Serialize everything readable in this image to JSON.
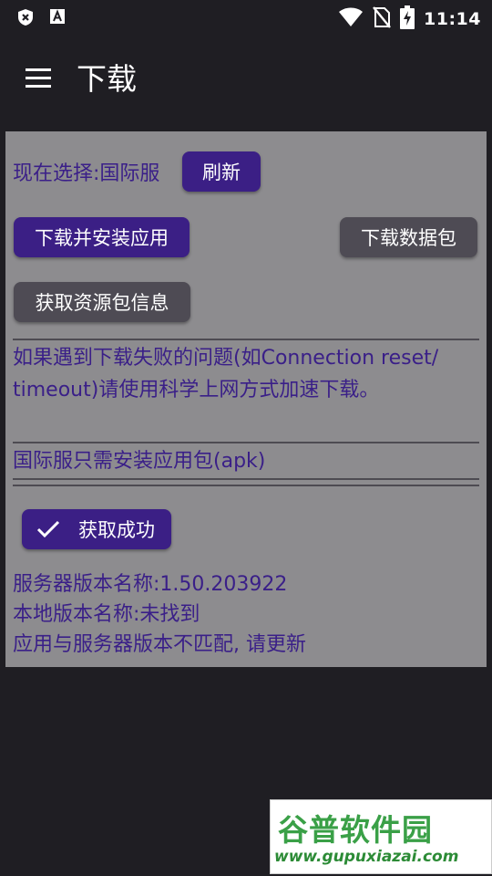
{
  "status_bar": {
    "time": "11:14",
    "icons": [
      "shield-x-icon",
      "a-font-icon",
      "wifi-icon",
      "no-sim-icon",
      "battery-charging-icon"
    ]
  },
  "app_bar": {
    "title": "下载",
    "menu_icon": "hamburger-menu-icon"
  },
  "content": {
    "current_selection": "现在选择:国际服",
    "refresh_label": "刷新",
    "download_install_label": "下载并安装应用",
    "download_data_label": "下载数据包",
    "get_resource_info_label": "获取资源包信息",
    "notice_text": "如果遇到下载失败的问题(如Connection reset/timeout)请使用科学上网方式加速下载。",
    "intl_note": "国际服只需安装应用包(apk)",
    "success_label": "获取成功",
    "server_version": "服务器版本名称:1.50.203922",
    "local_version": "本地版本名称:未找到",
    "mismatch_msg": "应用与服务器版本不匹配, 请更新"
  },
  "watermark": {
    "brand": "谷普软件园",
    "url": "www.gupuxiazai.com"
  },
  "colors": {
    "background": "#1f1e23",
    "panel": "#8d8c8f",
    "primary": "#3b1f85",
    "secondary": "#4e4b54",
    "text_accent": "#3a1f88"
  }
}
